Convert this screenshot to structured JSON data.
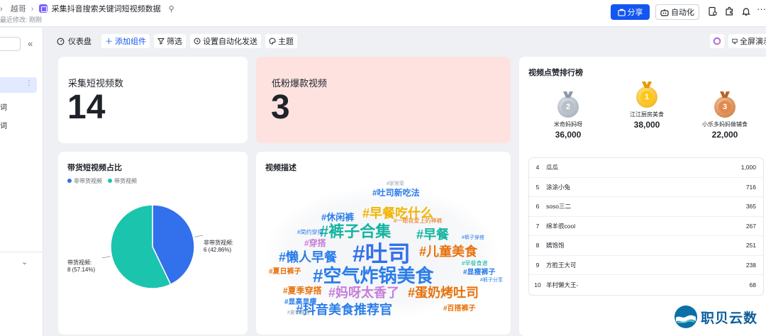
{
  "header": {
    "breadcrumb_prev": "越哥",
    "doc_title": "采集抖音搜索关键词短视频数据",
    "last_modified": "最近修改: 刚刚",
    "share_label": "分享",
    "automation_label": "自动化"
  },
  "sidebar": {
    "items": [
      "词",
      "词"
    ]
  },
  "toolbar": {
    "dashboard_label": "仪表盘",
    "add_component_label": "添加组件",
    "filter_label": "筛选",
    "auto_send_label": "设置自动化发送",
    "theme_label": "主题",
    "fullscreen_label": "全屏演示"
  },
  "kpis": [
    {
      "label": "采集短视频数",
      "value": "14"
    },
    {
      "label": "低粉爆款视频",
      "value": "3"
    }
  ],
  "pie_card": {
    "title": "带货短视频占比",
    "legend": [
      "非带货视频",
      "带货视频"
    ],
    "label_a_name": "非带货视频:",
    "label_a_value": "6 (42.86%)",
    "label_b_name": "带货视频:",
    "label_b_value": "8 (57.14%)"
  },
  "chart_data": {
    "type": "pie",
    "title": "带货短视频占比",
    "slices": [
      {
        "name": "非带货视频",
        "value": 6,
        "percent": 42.86
      },
      {
        "name": "带货视频",
        "value": 8,
        "percent": 57.14
      }
    ],
    "legend_position": "top-left",
    "colors": [
      "#3370eb",
      "#1bc4ad"
    ]
  },
  "wordcloud_card": {
    "title": "视频描述",
    "words": [
      {
        "text": "#吐司",
        "color": "#3370eb"
      },
      {
        "text": "#空气炸锅美食",
        "color": "#2b7de9"
      },
      {
        "text": "#裤子合集",
        "color": "#14b4a0"
      },
      {
        "text": "#儿童美食",
        "color": "#e8710a"
      },
      {
        "text": "#懒人早餐",
        "color": "#2b7de9"
      },
      {
        "text": "#早餐吃什么",
        "color": "#f2b400"
      },
      {
        "text": "#妈呀太香了",
        "color": "#c77dd9"
      },
      {
        "text": "#蛋奶烤吐司",
        "color": "#e8710a"
      },
      {
        "text": "#抖音美食推荐官",
        "color": "#2b7de9"
      },
      {
        "text": "#早餐",
        "color": "#14b4a0"
      },
      {
        "text": "#休闲裤",
        "color": "#2b7de9"
      },
      {
        "text": "#吐司新吃法",
        "color": "#2b7de9"
      },
      {
        "text": "#夏季穿搭",
        "color": "#e8710a"
      },
      {
        "text": "#穿搭",
        "color": "#c77dd9"
      },
      {
        "text": "#夏日裤子",
        "color": "#e8710a"
      },
      {
        "text": "#显瘦裤子",
        "color": "#2b7de9"
      },
      {
        "text": "#百搭裤子",
        "color": "#e8710a"
      },
      {
        "text": "#显高显瘦",
        "color": "#2b7de9"
      },
      {
        "text": "#简约穿搭",
        "color": "#2b7de9"
      },
      {
        "text": "#一眼就爱上的神裤",
        "color": "#e8710a"
      },
      {
        "text": "#裤子分享",
        "color": "#2b7de9"
      },
      {
        "text": "#早餐食谱",
        "color": "#14b4a0"
      },
      {
        "text": "#裤子穿搭",
        "color": "#2b7de9"
      },
      {
        "text": "#夏季穿搭",
        "color": "#9aa5b1"
      },
      {
        "text": "#家常菜",
        "color": "#9aa5b1"
      }
    ]
  },
  "ranking": {
    "title": "视频点赞排行榜",
    "top3": [
      {
        "rank": "2",
        "name": "米奇妈妈呀",
        "value": "36,000",
        "color": "#aeb6bf"
      },
      {
        "rank": "1",
        "name": "江江厨房美食",
        "value": "38,000",
        "color": "#f2b400"
      },
      {
        "rank": "3",
        "name": "小乐多妈妈做辅食",
        "value": "22,000",
        "color": "#d9804a"
      }
    ],
    "rows": [
      {
        "no": "4",
        "name": "瓜瓜",
        "value": "1,000"
      },
      {
        "no": "5",
        "name": "涂涂小兔",
        "value": "716"
      },
      {
        "no": "6",
        "name": "soso三二",
        "value": "365"
      },
      {
        "no": "7",
        "name": "绵羊很cool",
        "value": "267"
      },
      {
        "no": "8",
        "name": "嫣饱饱",
        "value": "251"
      },
      {
        "no": "9",
        "name": "方脸王大可",
        "value": "238"
      },
      {
        "no": "10",
        "name": "羊村懒大王-",
        "value": "68"
      }
    ]
  },
  "logo": {
    "text": "职贝云数"
  }
}
